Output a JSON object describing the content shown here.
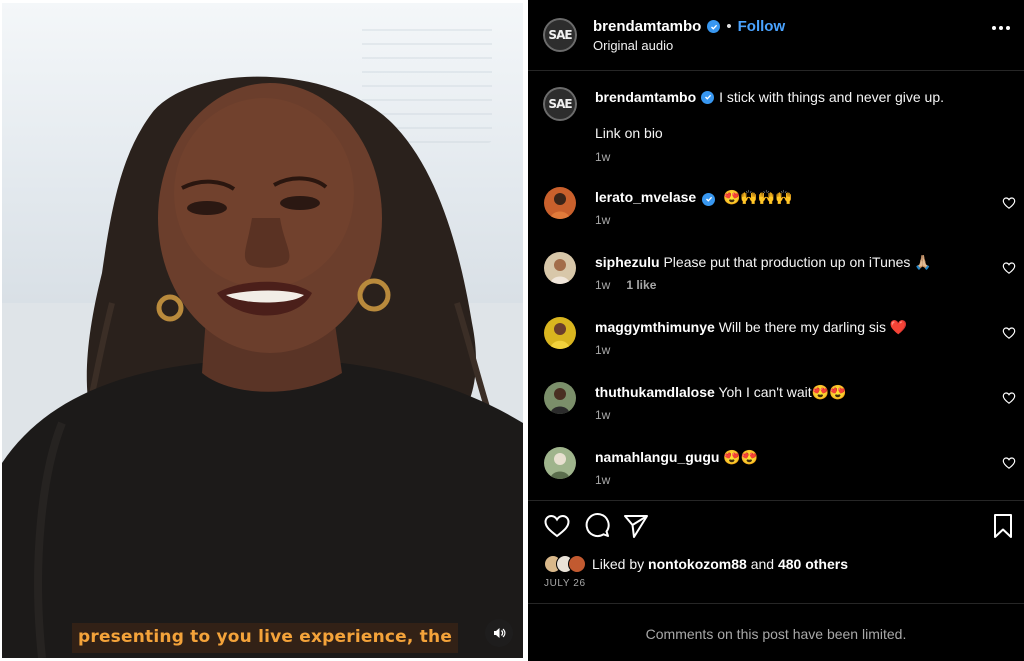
{
  "post": {
    "author": "brendamtambo",
    "follow_label": "Follow",
    "dot": "•",
    "audio": "Original audio",
    "caption_line1": "I stick with things and never give up.",
    "caption_line2": "Link on bio",
    "caption_time": "1w",
    "author_logo_text": "SAE"
  },
  "video": {
    "subtitle": "presenting to you live experience, the",
    "mute_icon": "speaker-icon"
  },
  "comments": [
    {
      "user": "lerato_mvelase",
      "verified": true,
      "text": "😍🙌🙌🙌",
      "time": "1w",
      "likes": "",
      "avatar_color": "#c9602c"
    },
    {
      "user": "siphezulu",
      "verified": false,
      "text": "Please put that production up on iTunes 🙏🏼",
      "time": "1w",
      "likes": "1 like",
      "avatar_color": "#d8c7a9"
    },
    {
      "user": "maggymthimunye",
      "verified": false,
      "text": "Will be there my darling sis ❤️",
      "time": "1w",
      "likes": "",
      "avatar_color": "#d9b51f"
    },
    {
      "user": "thuthukamdlalose",
      "verified": false,
      "text": "Yoh I can't wait😍😍",
      "time": "1w",
      "likes": "",
      "avatar_color": "#7b8f6a"
    },
    {
      "user": "namahlangu_gugu",
      "verified": false,
      "text": "😍😍",
      "time": "1w",
      "likes": "",
      "avatar_color": "#9fb48c"
    }
  ],
  "likes": {
    "prefix": "Liked by",
    "first_user": "nontokozom88",
    "and": "and",
    "others": "480 others"
  },
  "date": "JULY 26",
  "limited_notice": "Comments on this post have been limited.",
  "colors": {
    "panel_bg": "#000000",
    "link_blue": "#4aa3ff",
    "verified_blue": "#3897f0",
    "subtitle_orange": "#f4a33a"
  }
}
